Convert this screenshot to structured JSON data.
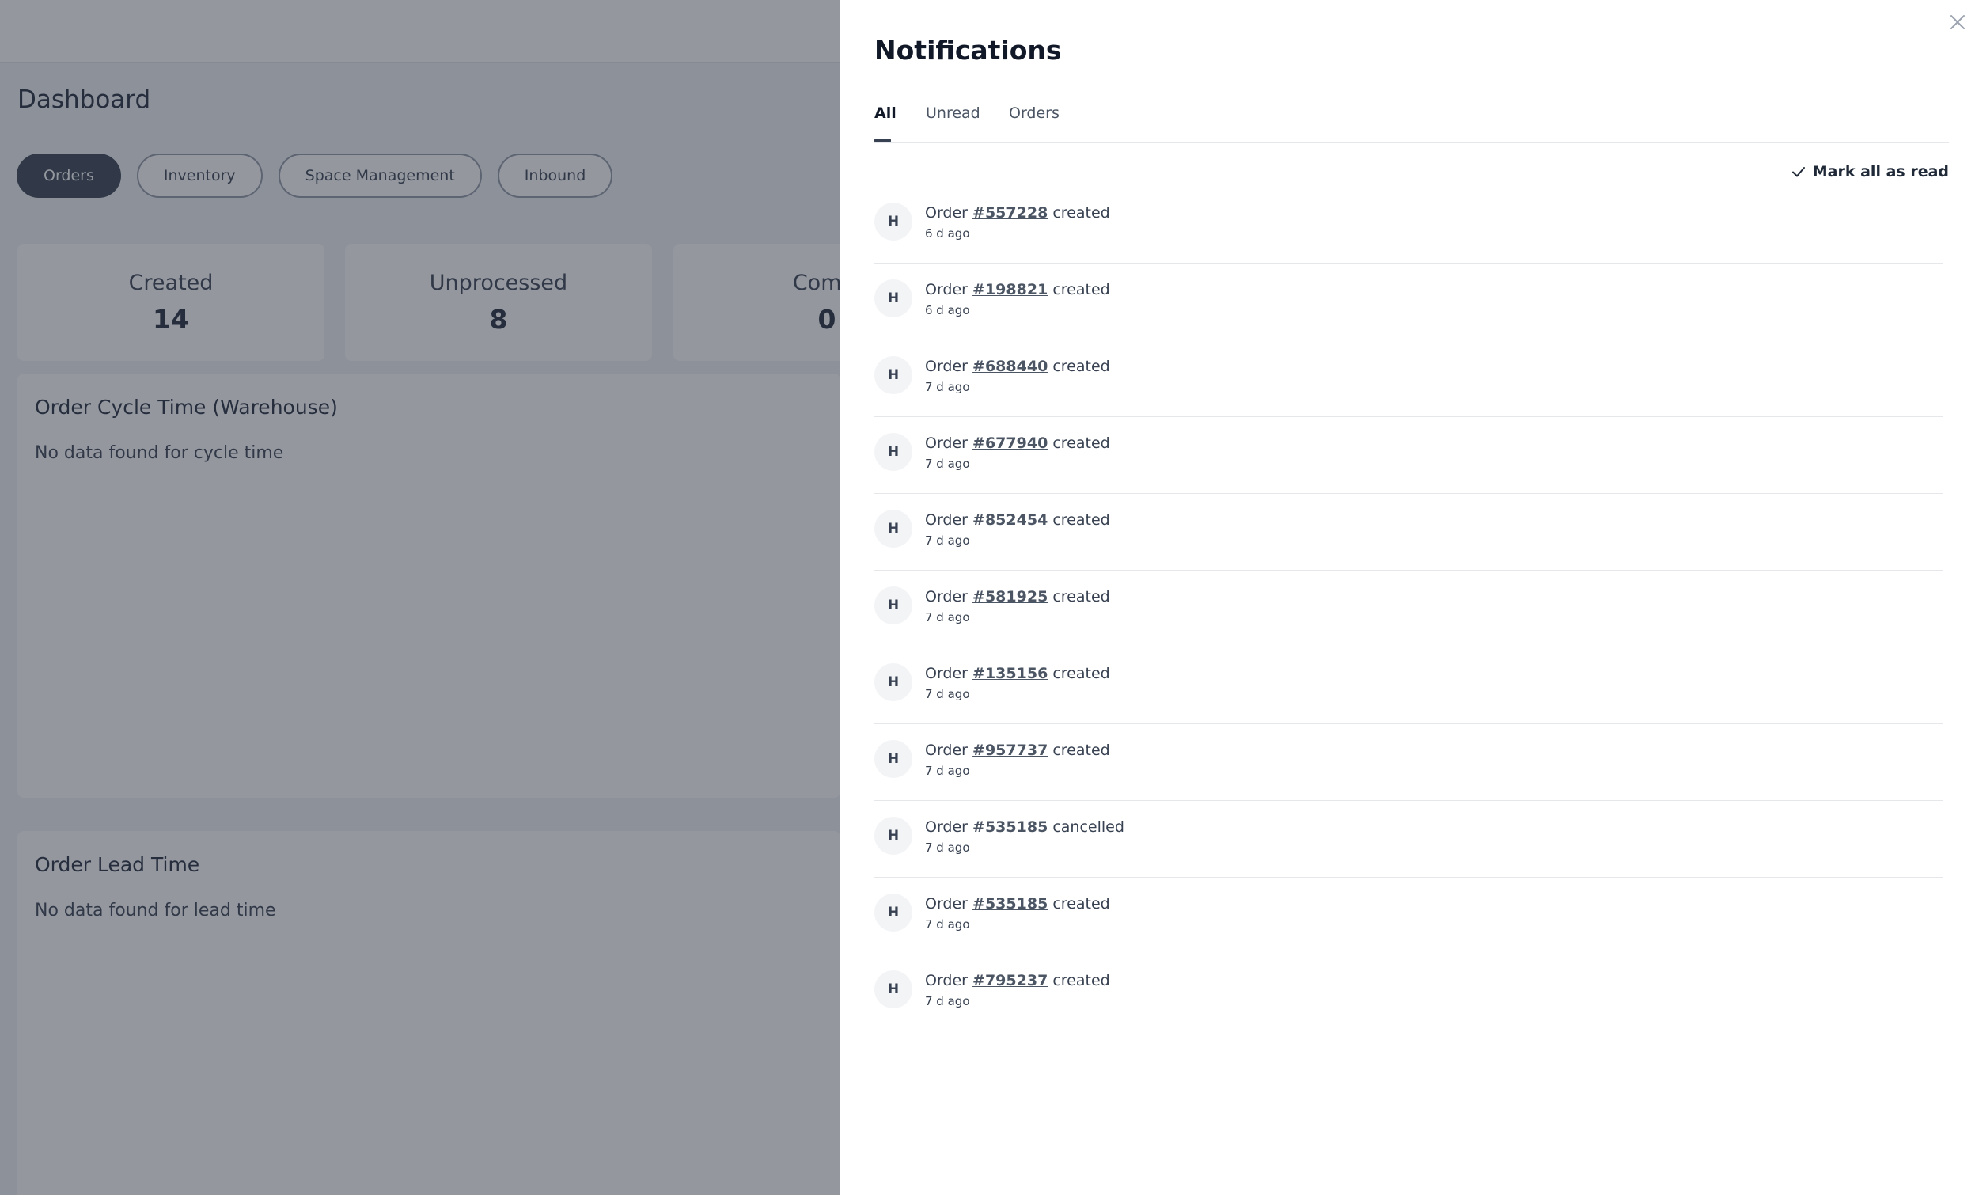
{
  "dashboard": {
    "title": "Dashboard",
    "tabs": [
      "Orders",
      "Inventory",
      "Space Management",
      "Inbound"
    ],
    "active_tab": "Orders",
    "stats": [
      {
        "label": "Created",
        "value": "14"
      },
      {
        "label": "Unprocessed",
        "value": "8"
      },
      {
        "label": "Compl",
        "value": "0"
      }
    ],
    "panels": [
      {
        "title": "Order Cycle Time (Warehouse)",
        "message": "No data found for cycle time"
      },
      {
        "title": "Order Lead Time",
        "message": "No data found for lead time"
      }
    ]
  },
  "notifications": {
    "title": "Notifications",
    "tabs": [
      "All",
      "Unread",
      "Orders"
    ],
    "active_tab": "All",
    "mark_all_label": "Mark all as read",
    "items": [
      {
        "avatar": "H",
        "prefix": "Order",
        "order_id": "#557228",
        "action": "created",
        "time": "6 d ago"
      },
      {
        "avatar": "H",
        "prefix": "Order",
        "order_id": "#198821",
        "action": "created",
        "time": "6 d ago"
      },
      {
        "avatar": "H",
        "prefix": "Order",
        "order_id": "#688440",
        "action": "created",
        "time": "7 d ago"
      },
      {
        "avatar": "H",
        "prefix": "Order",
        "order_id": "#677940",
        "action": "created",
        "time": "7 d ago"
      },
      {
        "avatar": "H",
        "prefix": "Order",
        "order_id": "#852454",
        "action": "created",
        "time": "7 d ago"
      },
      {
        "avatar": "H",
        "prefix": "Order",
        "order_id": "#581925",
        "action": "created",
        "time": "7 d ago"
      },
      {
        "avatar": "H",
        "prefix": "Order",
        "order_id": "#135156",
        "action": "created",
        "time": "7 d ago"
      },
      {
        "avatar": "H",
        "prefix": "Order",
        "order_id": "#957737",
        "action": "created",
        "time": "7 d ago"
      },
      {
        "avatar": "H",
        "prefix": "Order",
        "order_id": "#535185",
        "action": "cancelled",
        "time": "7 d ago"
      },
      {
        "avatar": "H",
        "prefix": "Order",
        "order_id": "#535185",
        "action": "created",
        "time": "7 d ago"
      },
      {
        "avatar": "H",
        "prefix": "Order",
        "order_id": "#795237",
        "action": "created",
        "time": "7 d ago"
      }
    ]
  },
  "icons": {
    "close": "close-icon",
    "mark_all": "check-icon"
  },
  "colors": {
    "overlay": "#111827",
    "accent": "#374151",
    "active_pill": "#4b5563"
  }
}
